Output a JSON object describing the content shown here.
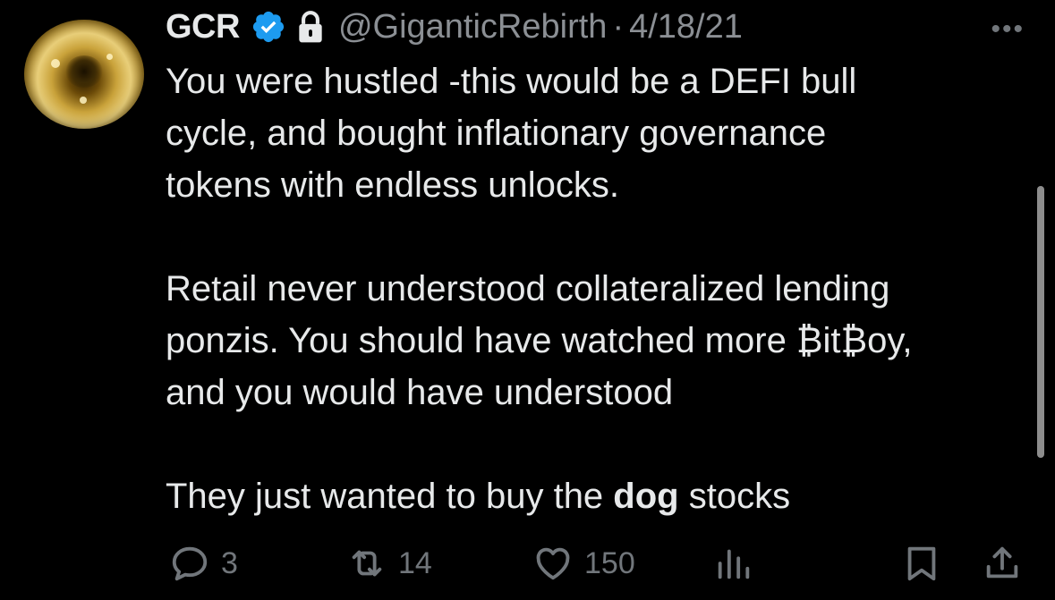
{
  "tweet": {
    "author_name": "GCR",
    "handle": "@GiganticRebirth",
    "separator": "·",
    "date": "4/18/21",
    "more": "•••",
    "text_lines": {
      "l1": "You were hustled -this would be a DEFI bull",
      "l2": "cycle, and bought inflationary governance",
      "l3": "tokens with endless unlocks.",
      "l4": "Retail never understood collateralized lending",
      "l5": "ponzis.  You should have watched more ₿it₿oy,",
      "l6": "and you would have understood",
      "l7_before": "They just wanted to buy the ",
      "l7_bold": "dog",
      "l7_after": " stocks"
    },
    "actions": {
      "replies": "3",
      "retweets": "14",
      "likes": "150"
    }
  },
  "icons": {
    "verified": "verified-badge-icon",
    "lock": "lock-icon",
    "reply": "reply-icon",
    "retweet": "retweet-icon",
    "like": "heart-icon",
    "views": "views-icon",
    "bookmark": "bookmark-icon",
    "share": "share-icon"
  },
  "colors": {
    "background": "#000000",
    "text": "#e7e9ea",
    "muted": "#71767b",
    "verified": "#1d9bf0"
  }
}
